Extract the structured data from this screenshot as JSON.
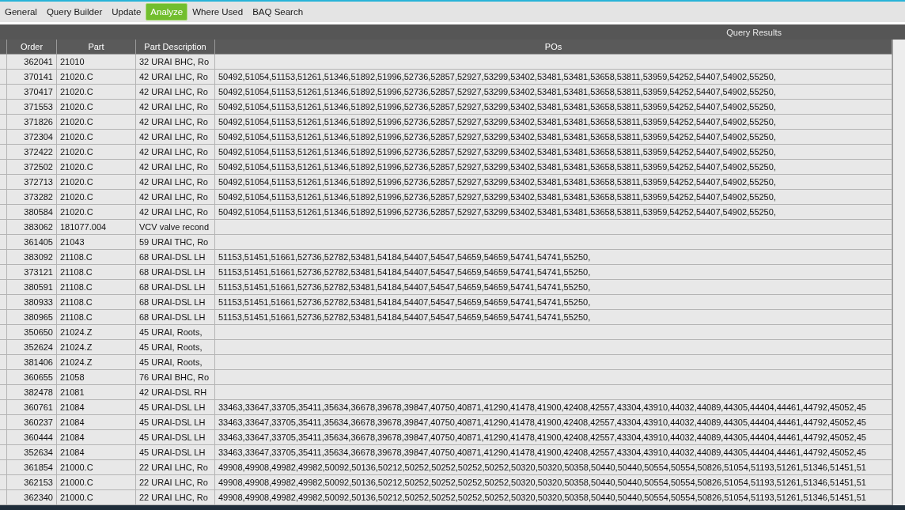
{
  "tabs": [
    {
      "label": "General",
      "selected": false
    },
    {
      "label": "Query Builder",
      "selected": false
    },
    {
      "label": "Update",
      "selected": false
    },
    {
      "label": "Analyze",
      "selected": true
    },
    {
      "label": "Where Used",
      "selected": false
    },
    {
      "label": "BAQ Search",
      "selected": false
    }
  ],
  "panel": {
    "title": "Query Results"
  },
  "table": {
    "columns": [
      "Order",
      "Part",
      "Part Description",
      "POs"
    ],
    "rows": [
      [
        "362041",
        "21010",
        "32 URAI BHC, Ro",
        ""
      ],
      [
        "370141",
        "21020.C",
        "42 URAI LHC, Ro",
        "50492,51054,51153,51261,51346,51892,51996,52736,52857,52927,53299,53402,53481,53481,53658,53811,53959,54252,54407,54902,55250,"
      ],
      [
        "370417",
        "21020.C",
        "42 URAI LHC, Ro",
        "50492,51054,51153,51261,51346,51892,51996,52736,52857,52927,53299,53402,53481,53481,53658,53811,53959,54252,54407,54902,55250,"
      ],
      [
        "371553",
        "21020.C",
        "42 URAI LHC, Ro",
        "50492,51054,51153,51261,51346,51892,51996,52736,52857,52927,53299,53402,53481,53481,53658,53811,53959,54252,54407,54902,55250,"
      ],
      [
        "371826",
        "21020.C",
        "42 URAI LHC, Ro",
        "50492,51054,51153,51261,51346,51892,51996,52736,52857,52927,53299,53402,53481,53481,53658,53811,53959,54252,54407,54902,55250,"
      ],
      [
        "372304",
        "21020.C",
        "42 URAI LHC, Ro",
        "50492,51054,51153,51261,51346,51892,51996,52736,52857,52927,53299,53402,53481,53481,53658,53811,53959,54252,54407,54902,55250,"
      ],
      [
        "372422",
        "21020.C",
        "42 URAI LHC, Ro",
        "50492,51054,51153,51261,51346,51892,51996,52736,52857,52927,53299,53402,53481,53481,53658,53811,53959,54252,54407,54902,55250,"
      ],
      [
        "372502",
        "21020.C",
        "42 URAI LHC, Ro",
        "50492,51054,51153,51261,51346,51892,51996,52736,52857,52927,53299,53402,53481,53481,53658,53811,53959,54252,54407,54902,55250,"
      ],
      [
        "372713",
        "21020.C",
        "42 URAI LHC, Ro",
        "50492,51054,51153,51261,51346,51892,51996,52736,52857,52927,53299,53402,53481,53481,53658,53811,53959,54252,54407,54902,55250,"
      ],
      [
        "373282",
        "21020.C",
        "42 URAI LHC, Ro",
        "50492,51054,51153,51261,51346,51892,51996,52736,52857,52927,53299,53402,53481,53481,53658,53811,53959,54252,54407,54902,55250,"
      ],
      [
        "380584",
        "21020.C",
        "42 URAI LHC, Ro",
        "50492,51054,51153,51261,51346,51892,51996,52736,52857,52927,53299,53402,53481,53481,53658,53811,53959,54252,54407,54902,55250,"
      ],
      [
        "383062",
        "181077.004",
        "VCV valve recond",
        ""
      ],
      [
        "361405",
        "21043",
        "59 URAI THC, Ro",
        ""
      ],
      [
        "383092",
        "21108.C",
        "68 URAI-DSL LH",
        "51153,51451,51661,52736,52782,53481,54184,54407,54547,54659,54659,54741,54741,55250,"
      ],
      [
        "373121",
        "21108.C",
        "68 URAI-DSL LH",
        "51153,51451,51661,52736,52782,53481,54184,54407,54547,54659,54659,54741,54741,55250,"
      ],
      [
        "380591",
        "21108.C",
        "68 URAI-DSL LH",
        "51153,51451,51661,52736,52782,53481,54184,54407,54547,54659,54659,54741,54741,55250,"
      ],
      [
        "380933",
        "21108.C",
        "68 URAI-DSL LH",
        "51153,51451,51661,52736,52782,53481,54184,54407,54547,54659,54659,54741,54741,55250,"
      ],
      [
        "380965",
        "21108.C",
        "68 URAI-DSL LH",
        "51153,51451,51661,52736,52782,53481,54184,54407,54547,54659,54659,54741,54741,55250,"
      ],
      [
        "350650",
        "21024.Z",
        "45 URAI, Roots,",
        ""
      ],
      [
        "352624",
        "21024.Z",
        "45 URAI, Roots,",
        ""
      ],
      [
        "381406",
        "21024.Z",
        "45 URAI, Roots,",
        ""
      ],
      [
        "360655",
        "21058",
        "76 URAI BHC, Ro",
        ""
      ],
      [
        "382478",
        "21081",
        "42 URAI-DSL RH",
        ""
      ],
      [
        "360761",
        "21084",
        "45 URAI-DSL LH",
        "33463,33647,33705,35411,35634,36678,39678,39847,40750,40871,41290,41478,41900,42408,42557,43304,43910,44032,44089,44305,44404,44461,44792,45052,45"
      ],
      [
        "360237",
        "21084",
        "45 URAI-DSL LH",
        "33463,33647,33705,35411,35634,36678,39678,39847,40750,40871,41290,41478,41900,42408,42557,43304,43910,44032,44089,44305,44404,44461,44792,45052,45"
      ],
      [
        "360444",
        "21084",
        "45 URAI-DSL LH",
        "33463,33647,33705,35411,35634,36678,39678,39847,40750,40871,41290,41478,41900,42408,42557,43304,43910,44032,44089,44305,44404,44461,44792,45052,45"
      ],
      [
        "352634",
        "21084",
        "45 URAI-DSL LH",
        "33463,33647,33705,35411,35634,36678,39678,39847,40750,40871,41290,41478,41900,42408,42557,43304,43910,44032,44089,44305,44404,44461,44792,45052,45"
      ],
      [
        "361854",
        "21000.C",
        "22 URAI LHC, Ro",
        "49908,49908,49982,49982,50092,50136,50212,50252,50252,50252,50252,50320,50320,50358,50440,50440,50554,50554,50826,51054,51193,51261,51346,51451,51"
      ],
      [
        "362153",
        "21000.C",
        "22 URAI LHC, Ro",
        "49908,49908,49982,49982,50092,50136,50212,50252,50252,50252,50252,50320,50320,50358,50440,50440,50554,50554,50826,51054,51193,51261,51346,51451,51"
      ],
      [
        "362340",
        "21000.C",
        "22 URAI LHC, Ro",
        "49908,49908,49982,49982,50092,50136,50212,50252,50252,50252,50252,50320,50320,50358,50440,50440,50554,50554,50826,51054,51193,51261,51346,51451,51"
      ]
    ]
  }
}
